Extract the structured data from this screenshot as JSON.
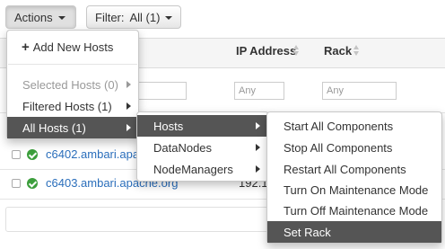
{
  "toolbar": {
    "actions_label": "Actions",
    "filter_label": "Filter:",
    "filter_value": "All (1)"
  },
  "table": {
    "columns": [
      "IP Address",
      "Rack"
    ],
    "filters": {
      "ip_placeholder": "Any",
      "rack_placeholder": "Any"
    },
    "rows": [
      {
        "host": "c6402.ambari.apache.org",
        "ip_fragment": ""
      },
      {
        "host": "c6403.ambari.apache.org",
        "ip_fragment": "192.1"
      }
    ]
  },
  "actions_menu": {
    "add_new_hosts": "Add New Hosts",
    "selected_hosts": "Selected Hosts (0)",
    "filtered_hosts": "Filtered Hosts (1)",
    "all_hosts": "All Hosts (1)"
  },
  "all_hosts_submenu": {
    "items": [
      "Hosts",
      "DataNodes",
      "NodeManagers"
    ]
  },
  "hosts_submenu": {
    "items": [
      "Start All Components",
      "Stop All Components",
      "Restart All Components",
      "Turn On Maintenance Mode",
      "Turn Off Maintenance Mode",
      "Set Rack"
    ]
  },
  "colors": {
    "link": "#2a6ebb",
    "status_ok": "#3c9e3c",
    "menu_active": "#555555"
  }
}
